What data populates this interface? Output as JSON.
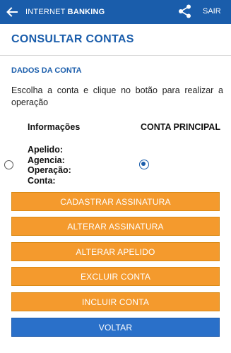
{
  "header": {
    "title_regular": "INTERNET",
    "title_bold": "BANKING",
    "exit_label": "SAIR",
    "back_icon": "arrow-left-icon",
    "share_icon": "share-icon"
  },
  "page": {
    "title": "CONSULTAR CONTAS",
    "section_title": "DADOS DA CONTA",
    "instruction": "Escolha a conta e clique no botão para realizar a operação"
  },
  "table": {
    "col_info": "Informações",
    "col_account": "CONTA PRINCIPAL",
    "fields": [
      "Apelido:",
      "Agencia:",
      "Operação:",
      "Conta:"
    ],
    "left_radio_selected": false,
    "right_radio_selected": true
  },
  "actions": {
    "register_signature": "CADASTRAR ASSINATURA",
    "change_signature": "ALTERAR ASSINATURA",
    "change_nickname": "ALTERAR APELIDO",
    "delete_account": "EXCLUIR CONTA",
    "add_account": "INCLUIR CONTA",
    "back": "VOLTAR"
  },
  "colors": {
    "primary_blue": "#1a5dab",
    "action_orange": "#f49a2d",
    "back_button_blue": "#2a70c9"
  }
}
